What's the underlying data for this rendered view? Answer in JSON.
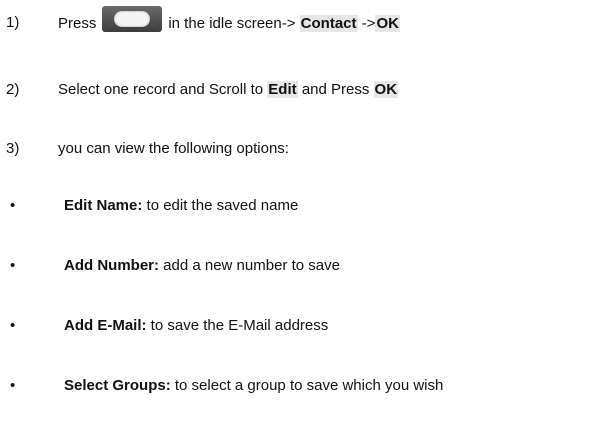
{
  "steps": [
    {
      "number": "1)",
      "parts": [
        "Press",
        "in the idle screen->",
        "Contact",
        "->",
        "OK"
      ],
      "icon": "end-key-icon"
    },
    {
      "number": "2)",
      "parts": [
        "Select one record and Scroll to",
        "Edit",
        "and Press",
        "OK"
      ]
    },
    {
      "number": "3)",
      "text": "you can view the following options:"
    }
  ],
  "options": [
    {
      "bullet": "•",
      "term": "Edit Name:",
      "desc": "to edit the saved name"
    },
    {
      "bullet": "•",
      "term": "Add Number:",
      "desc": "add a new number to save"
    },
    {
      "bullet": "•",
      "term": "Add E-Mail:",
      "desc": "to save the E-Mail address"
    },
    {
      "bullet": "•",
      "term": "Select Groups:",
      "desc": "to select a group to save which you wish"
    }
  ]
}
